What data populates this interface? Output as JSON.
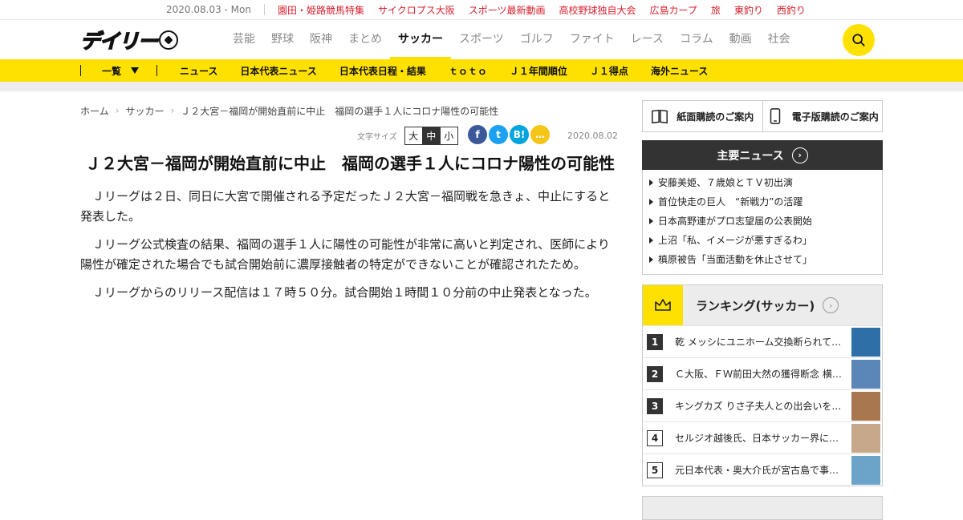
{
  "topbar": {
    "date": "2020.08.03 - Mon",
    "links": [
      "園田・姫路競馬特集",
      "サイクロプス大阪",
      "スポーツ最新動画",
      "高校野球独自大会",
      "広島カープ",
      "旅",
      "東釣り",
      "西釣り"
    ]
  },
  "header": {
    "logo_text": "デイリー",
    "nav": [
      "芸能",
      "野球",
      "阪神",
      "まとめ",
      "サッカー",
      "スポーツ",
      "ゴルフ",
      "ファイト",
      "レース",
      "コラム",
      "動画",
      "社会"
    ],
    "active_nav": "サッカー"
  },
  "subnav": {
    "dropdown_label": "一覧",
    "links": [
      "ニュース",
      "日本代表ニュース",
      "日本代表日程・結果",
      "ｔｏｔｏ",
      "Ｊ１年間順位",
      "Ｊ１得点",
      "海外ニュース"
    ]
  },
  "breadcrumb": [
    "ホーム",
    "サッカー",
    "Ｊ２大宮－福岡が開始直前に中止　福岡の選手１人にコロナ陽性の可能性"
  ],
  "tools": {
    "font_size_label": "文字サイズ",
    "sizes": [
      "大",
      "中",
      "小"
    ],
    "share": [
      {
        "name": "facebook",
        "glyph": "f",
        "color": "#3b5998"
      },
      {
        "name": "twitter",
        "glyph": "t",
        "color": "#1da1f2"
      },
      {
        "name": "hatena",
        "glyph": "B!",
        "color": "#00a4de"
      },
      {
        "name": "comment",
        "glyph": "…",
        "color": "#f5c518"
      }
    ],
    "date": "2020.08.02"
  },
  "article": {
    "title": "Ｊ２大宮－福岡が開始直前に中止　福岡の選手１人にコロナ陽性の可能性",
    "paragraphs": [
      "Ｊリーグは２日、同日に大宮で開催される予定だったＪ２大宮－福岡戦を急きょ、中止にすると発表した。",
      "Ｊリーグ公式検査の結果、福岡の選手１人に陽性の可能性が非常に高いと判定され、医師により陽性が確定された場合でも試合開始前に濃厚接触者の特定ができないことが確認されたため。",
      "Ｊリーグからのリリース配信は１７時５０分。試合開始１時間１０分前の中止発表となった。"
    ]
  },
  "sidebar": {
    "subscribe_paper": "紙面購読のご案内",
    "subscribe_digital": "電子版購読のご案内",
    "news_title": "主要ニュース",
    "news": [
      "安藤美姫、７歳娘とＴＶ初出演",
      "首位快走の巨人　“新戦力”の活躍",
      "日本高野連がプロ志望届の公表開始",
      "上沼「私、イメージが悪すぎるわ」",
      "槙原被告「当面活動を休止させて」"
    ],
    "ranking_title": "ランキング(サッカー)",
    "ranking": [
      {
        "rank": "1",
        "text": "乾 メッシにユニホーム交換断られて…",
        "thumb": "#2e6fa8"
      },
      {
        "rank": "2",
        "text": "Ｃ大阪、ＦＷ前田大然の獲得断念 横…",
        "thumb": "#5a86b8"
      },
      {
        "rank": "3",
        "text": "キングカズ りさ子夫人との出会いを…",
        "thumb": "#a8774f"
      },
      {
        "rank": "4",
        "text": "セルジオ越後氏、日本サッカー界に苦…",
        "thumb": "#c7a88a"
      },
      {
        "rank": "5",
        "text": "元日本代表・奥大介氏が宮古島で事故死",
        "thumb": "#6aa5c9"
      }
    ]
  }
}
